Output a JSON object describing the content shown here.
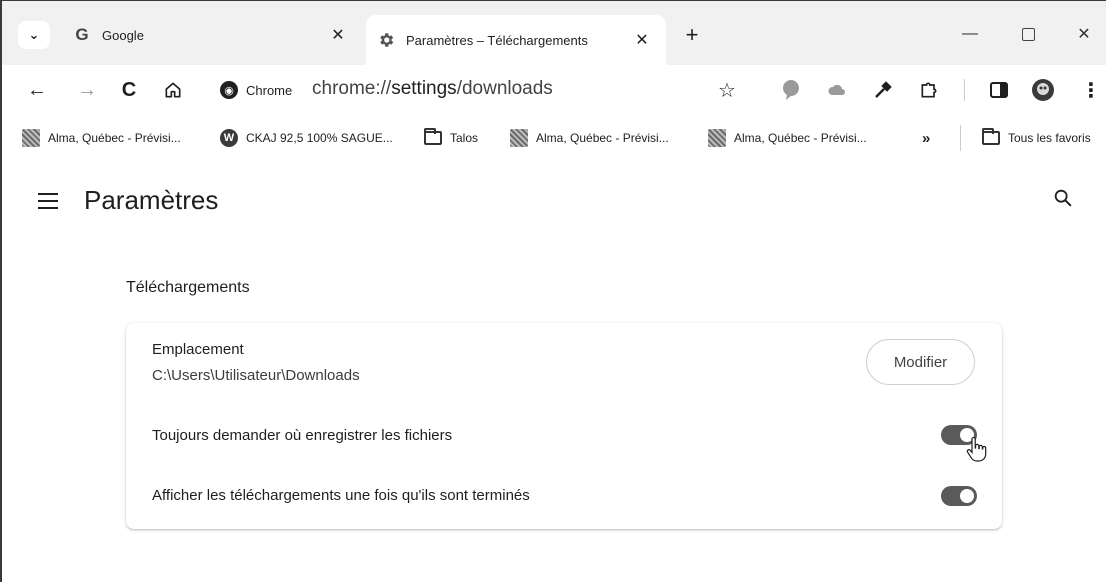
{
  "tabs": {
    "search_glyph": "⌄",
    "inactive": {
      "title": "Google",
      "favicon": "G"
    },
    "active": {
      "title": "Paramètres – Téléchargements"
    },
    "close_glyph": "✕",
    "new_tab_glyph": "+"
  },
  "window_controls": {
    "minimize": "—",
    "close": "✕"
  },
  "toolbar": {
    "back": "←",
    "forward": "→",
    "reload": "C",
    "site_chip": "Chrome",
    "url_scheme": "chrome://",
    "url_host": "settings",
    "url_path": "/downloads",
    "star": "☆",
    "menu": "⋮"
  },
  "bookmarks": [
    {
      "label": "Alma, Québec - Prévisi...",
      "icon": "thumb"
    },
    {
      "label": "CKAJ 92,5 100% SAGUE...",
      "icon": "wordpress"
    },
    {
      "label": "Talos",
      "icon": "folder"
    },
    {
      "label": "Alma, Québec - Prévisi...",
      "icon": "thumb"
    },
    {
      "label": "Alma, Québec - Prévisi...",
      "icon": "thumb"
    }
  ],
  "bookmarks_overflow": "»",
  "bookmarks_all": "Tous les favoris",
  "settings": {
    "title": "Paramètres",
    "section": "Téléchargements",
    "location": {
      "label": "Emplacement",
      "path": "C:\\Users\\Utilisateur\\Downloads",
      "button": "Modifier"
    },
    "ask_where": {
      "label": "Toujours demander où enregistrer les fichiers",
      "enabled": true
    },
    "show_when_done": {
      "label": "Afficher les téléchargements une fois qu'ils sont terminés",
      "enabled": true
    }
  },
  "colors": {
    "toggle_on": "#5a5a5a",
    "tabstrip": "#f1f1f1"
  }
}
